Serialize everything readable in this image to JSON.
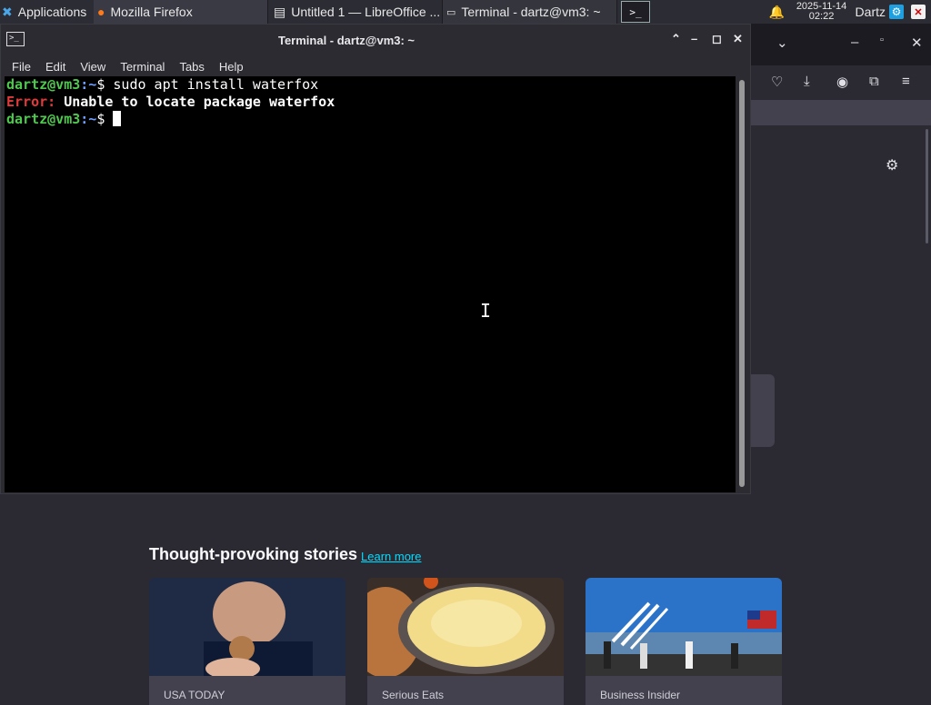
{
  "taskbar": {
    "applications_label": "Applications",
    "tasks": [
      {
        "label": "Mozilla Firefox",
        "icon": "firefox-icon"
      },
      {
        "label": "Untitled 1 — LibreOffice ...",
        "icon": "document-icon"
      },
      {
        "label": "Terminal - dartz@vm3: ~",
        "icon": "terminal-icon"
      }
    ],
    "clock_date": "2025-11-14",
    "clock_time": "02:22",
    "user": "Dartz"
  },
  "terminal": {
    "title": "Terminal - dartz@vm3: ~",
    "menu": [
      "File",
      "Edit",
      "View",
      "Terminal",
      "Tabs",
      "Help"
    ],
    "lines": [
      {
        "user": "dartz@vm3",
        "path": ":~",
        "symbol": "$ ",
        "command": "sudo apt install waterfox"
      },
      {
        "error_label": "Error:",
        "message": " Unable to locate package waterfox"
      },
      {
        "user": "dartz@vm3",
        "path": ":~",
        "symbol": "$ ",
        "command": ""
      }
    ]
  },
  "firefox": {
    "stories_title": "Thought-provoking stories",
    "learn_more": "Learn more",
    "cards": [
      {
        "source": "USA TODAY"
      },
      {
        "source": "Serious Eats"
      },
      {
        "source": "Business Insider"
      }
    ]
  }
}
